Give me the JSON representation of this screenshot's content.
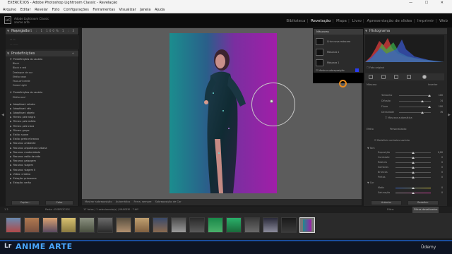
{
  "window": {
    "title": "EXERCÍCIOS - Adobe Photoshop Lightroom Classic - Revelação",
    "controls": [
      "—",
      "☐",
      "✕"
    ]
  },
  "menu": [
    "Arquivo",
    "Editar",
    "Revelar",
    "Foto",
    "Configurações",
    "Ferramentas",
    "Visualizar",
    "Janela",
    "Ajuda"
  ],
  "identity": {
    "badge": "LrC",
    "line1": "Adobe Lightroom Classic",
    "line2": "anime arte"
  },
  "modules": {
    "items": [
      "Biblioteca",
      "Revelação",
      "Mapa",
      "Livro",
      "Apresentação de slides",
      "Imprimir",
      "Web"
    ],
    "active": "Revelação"
  },
  "left_panel": {
    "navigator": {
      "title": "Navegador",
      "zoom_options": "AJUST 1 : 1 100% 1 : 3"
    },
    "presets_title": "Predefinições",
    "group1": "Predefinições do usuário",
    "presets1": [
      "Black",
      "Black e red",
      "Destaque de cor",
      "Efeito neon",
      "Faux-art verde",
      "Green Light"
    ],
    "group2": "Predefinições do usuário",
    "presets2": [
      "Efeito azul"
    ],
    "groups": [
      "Adaptável: retrato",
      "Adaptável: céu",
      "Adaptável: objeto",
      "Filmes: pele negra",
      "Filmes: pele média",
      "Filmes: pele clara",
      "Filmes: grupo",
      "Estilo: suave",
      "Estilo: preto e branco",
      "Recurso: ambiente",
      "Recurso: arquitetura urbana",
      "Recurso: modernidade",
      "Recurso: estilo de vida",
      "Recurso: paisagem",
      "Recurso: viagem",
      "Recurso: viagem II",
      "Vídeo: criativo",
      "Estação: primavera",
      "Estação: verão"
    ],
    "buttons": [
      "Copiar...",
      "Colar"
    ]
  },
  "mask_panel": {
    "title": "Máscaras",
    "rows": [
      "Criar nova máscara",
      "Máscara 2",
      "Máscara 1"
    ],
    "show_overlay": "Mostrar sobreposição",
    "overlay_color": "#2a3cf0"
  },
  "toolbar": {
    "text1": "Mostrar sobreposição",
    "mode1": "Automático",
    "text2": "Ferra. sempre",
    "mode2": "Sobreposição de Cor"
  },
  "right_panel": {
    "histogram_title": "Histograma",
    "original_label": "Foto original",
    "mask_label": "Máscara",
    "invert_label": "Inverter",
    "sliders1": [
      {
        "label": "Tamanho",
        "value": "100"
      },
      {
        "label": "Difusão",
        "value": "74"
      },
      {
        "label": "Fluxo",
        "value": "100"
      },
      {
        "label": "Densidade",
        "value": "76"
      }
    ],
    "mask_auto": "Máscara automática",
    "section_tone": "Tom",
    "sliders2": [
      {
        "label": "Exposição",
        "value": "0,00"
      },
      {
        "label": "Contraste",
        "value": "0"
      },
      {
        "label": "Realces",
        "value": "0"
      },
      {
        "label": "Sombras",
        "value": "0"
      },
      {
        "label": "Brancos",
        "value": "0"
      },
      {
        "label": "Pretos",
        "value": "0"
      }
    ],
    "section_color": "Cor",
    "sliders3": [
      {
        "label": "Matiz",
        "value": "0"
      },
      {
        "label": "Saturação",
        "value": "0"
      }
    ],
    "effect_label": "Efeito",
    "effect_value": "Personalizado",
    "reset_label": "Redefinir controles sozinho",
    "buttons": [
      "Anterior",
      "Redefinir"
    ]
  },
  "filmstrip_bar": {
    "nav": "1 2",
    "path": "Pasta : EXERCÍCIOS",
    "count": "17 fotos / 1 selecionado(s) / IMAGEM - 7.tiff",
    "filter_label": "Filtro:",
    "filter_value": "Filtros desativados"
  },
  "banner": {
    "lr": "Lr",
    "title": "ANIME ARTE",
    "brand": "Ûdemy"
  }
}
